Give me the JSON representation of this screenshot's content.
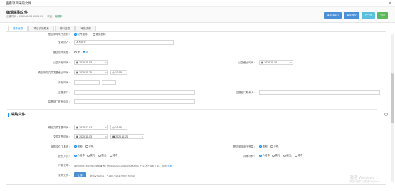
{
  "window": {
    "title": "查看项目采购文件",
    "close": "✕"
  },
  "header": {
    "title": "编辑采购文件",
    "created_label": "创建时间：",
    "created_value": "2020-11-03 10:00:09",
    "status_label": "状态：",
    "status_value": "编辑中",
    "buttons": [
      "保存(暂存)",
      "保存提交",
      "下一步",
      "关闭"
    ]
  },
  "tabs": [
    "基本信息",
    "项目实施联系",
    "资料信息",
    "审批流程"
  ],
  "form1": {
    "f0_label": "是否采用电子投标：",
    "f0_options": [
      "公开投标",
      "邀请投标"
    ],
    "f1_label": "发布媒介：",
    "f1_value": "发布媒介",
    "f2_label": "是否现场踏勘：",
    "f2_options": [
      "是",
      "否"
    ],
    "f3_label": "公告开始时间：",
    "f3_value": "2020-11-03",
    "f4_label": "公告截止时间：",
    "f4_value": "2020-11-10",
    "f5_label": "确定采购文件发售截止时间：",
    "f5_date": "2020-11-30",
    "f5_time": "17:00",
    "f6_label": "开始时间：",
    "f7_label": "监督部门：",
    "f8_label": "监督部门联系人：",
    "f9_label": "监督部门联系电话："
  },
  "section": {
    "title": "采购文件"
  },
  "form2": {
    "g1_label": "确定文件发售时间：",
    "g1_date": "2020-12-02",
    "g1_time": "17:00",
    "g2_label": "文件发售时间：",
    "g2_from": "2020-11-03",
    "g2_to": "2020-11-24",
    "g3_label": "采购文件工具有：",
    "g3_options": [
      "电脑",
      "手机"
    ],
    "g4_label": "是否采用电子签章：",
    "g4_options": [
      "电脑",
      "手机"
    ],
    "g5_label": "报价方式：",
    "g5_options": [
      "人民币",
      "美元",
      "欧元",
      "港币"
    ],
    "g6_label": "评审币种：",
    "g6_options": [
      "人民币",
      "美元",
      "欧元",
      "港币"
    ],
    "g7_label": "付款说明：",
    "g7_text": "[采购项目] 项目设立采购编号：HGD20201127800000000001 已导入开评标工具，点击",
    "g7_link": "查看",
    "g8_label": "采购文件：",
    "g8_button": "上传",
    "g8_note": "采购文件附件：(*.zip) 不要求采购文件内容"
  },
  "watermark": {
    "line1": "激活 Windows",
    "line2": "转到“设置”以激活 Windows。"
  }
}
